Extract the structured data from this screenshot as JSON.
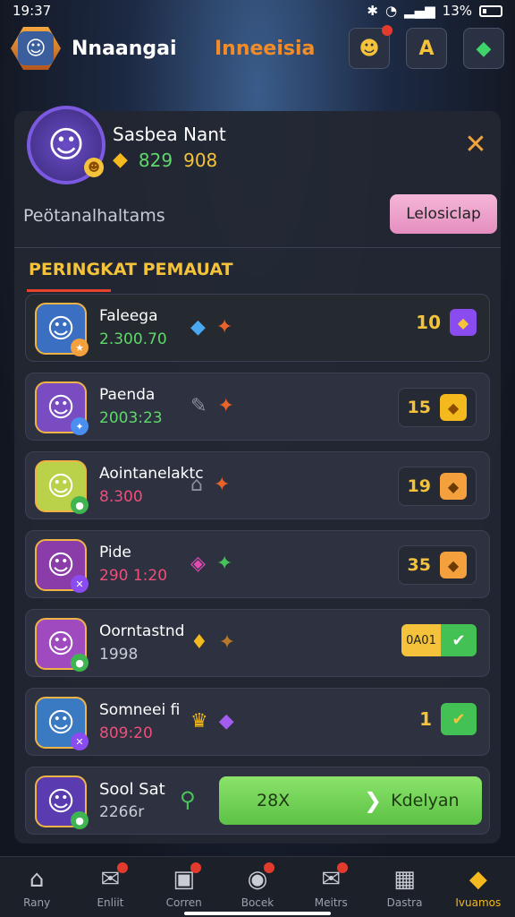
{
  "status": {
    "time": "19:37",
    "battery": "13%"
  },
  "topbar": {
    "name": "Nnaangai",
    "region": "Inneeisia"
  },
  "profile": {
    "name": "Sasbea Nant",
    "score_a": "829",
    "score_b": "908",
    "subtitle": "Peötanalhaltams",
    "action_label": "Lelosiclap"
  },
  "section_title": "PERINGKAT PEMAUAT",
  "rows": [
    {
      "name": "Faleega",
      "score": "2.300.70",
      "score_color": "#5fd86a",
      "rank": "10",
      "avatar_bg": "#3a6fc2",
      "cube_color": "#8a4cf0",
      "icons": [
        "◆",
        "✦"
      ]
    },
    {
      "name": "Paenda",
      "score": "2003:23",
      "score_color": "#5fd86a",
      "rank": "15",
      "avatar_bg": "#7a4cc2",
      "cube_color": "#f4b91c",
      "icons": [
        "✎",
        "✦"
      ]
    },
    {
      "name": "Aointanelaktc",
      "score": "8.300",
      "score_color": "#ef4f7a",
      "rank": "19",
      "avatar_bg": "#b9d24a",
      "cube_color": "#f4a03c",
      "icons": [
        "⌂",
        "✦"
      ]
    },
    {
      "name": "Pide",
      "score": "290 1:20",
      "score_color": "#ef4f7a",
      "rank": "35",
      "avatar_bg": "#8a3ca8",
      "cube_color": "#f4a03c",
      "icons": [
        "◈",
        "✦"
      ]
    },
    {
      "name": "Oorntastnd",
      "score": "1998",
      "score_color": "#c8ccd6",
      "claim_label": "0A01",
      "avatar_bg": "#a04ac0",
      "icons": [
        "♦",
        "✦"
      ]
    },
    {
      "name": "Somneei fi",
      "score": "809:20",
      "score_color": "#ef4f7a",
      "rank": "1",
      "avatar_bg": "#3a7ac2",
      "icons": [
        "♛",
        "◆"
      ]
    }
  ],
  "self_row": {
    "name": "Sool Sat",
    "score": "2266r",
    "amount": "28X",
    "button_label": "Kdelyan"
  },
  "nav": [
    {
      "label": "Rany",
      "icon": "home-icon",
      "dot": false,
      "active": false
    },
    {
      "label": "Enliit",
      "icon": "mail-icon",
      "dot": true,
      "active": false
    },
    {
      "label": "Corren",
      "icon": "bag-icon",
      "dot": true,
      "active": false
    },
    {
      "label": "Bocek",
      "icon": "camera-icon",
      "dot": true,
      "active": false
    },
    {
      "label": "Meitrs",
      "icon": "envelope-icon",
      "dot": true,
      "active": false
    },
    {
      "label": "Dastra",
      "icon": "grid-icon",
      "dot": false,
      "active": false
    },
    {
      "label": "Ivuamos",
      "icon": "gem-icon",
      "dot": false,
      "active": true
    }
  ]
}
